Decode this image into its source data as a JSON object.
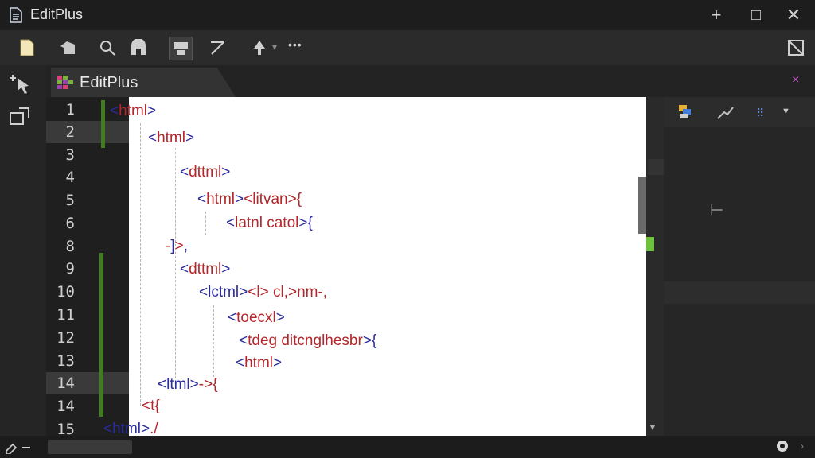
{
  "app": {
    "title": "EditPlus"
  },
  "window": {
    "add_label": "+",
    "restore_label": "□",
    "close_label": "✕"
  },
  "toolbar": {
    "more_label": "•••"
  },
  "tab": {
    "label": "EditPlus",
    "close_label": "×"
  },
  "line_numbers": [
    "1",
    "2",
    "3",
    "4",
    "5",
    "6",
    "8",
    "9",
    "10",
    "11",
    "12",
    "11",
    "13",
    "14",
    "14",
    "15"
  ],
  "code_lines": [
    {
      "a": "<",
      "t": "html",
      "b": ">"
    },
    {
      "a": "<",
      "t": "html",
      "b": ">"
    },
    {
      "a": "<",
      "t": "dttml",
      "b": ">"
    },
    {
      "a": "<",
      "t": "html",
      "b": ">",
      "tail": "<litvan>{"
    },
    {
      "a": "<",
      "t": "latnl catol",
      "b": ">",
      "tail": "{"
    },
    {
      "a": "-",
      "t": "]",
      "b": ">",
      "tail": ","
    },
    {
      "a": "<",
      "t": "dttml",
      "b": ">"
    },
    {
      "a": "<",
      "t": "lctml",
      "b": ">",
      "tail": "<l> cl,>nm-,"
    },
    {
      "a": "<",
      "t": "toecxl",
      "b": ">"
    },
    {
      "a": "<",
      "t": "tdeg ditcnglhesbr",
      "b": ">",
      "tail": "{"
    },
    {
      "a": "<",
      "t": "html",
      "b": ">"
    },
    {
      "a": "<",
      "t": "ltml",
      "b": ">",
      "tail": "->{"
    },
    {
      "a": "<",
      "t": "t",
      "b": "",
      "tail": "{"
    },
    {
      "a": "<",
      "t": "html",
      "b": ">",
      "tail": "./"
    }
  ],
  "right_panel": {
    "cursor_glyph": "⊢"
  },
  "colors": {
    "accent": "#3f7d1e",
    "tag": "#2b2b9f",
    "attr": "#b3262c"
  }
}
